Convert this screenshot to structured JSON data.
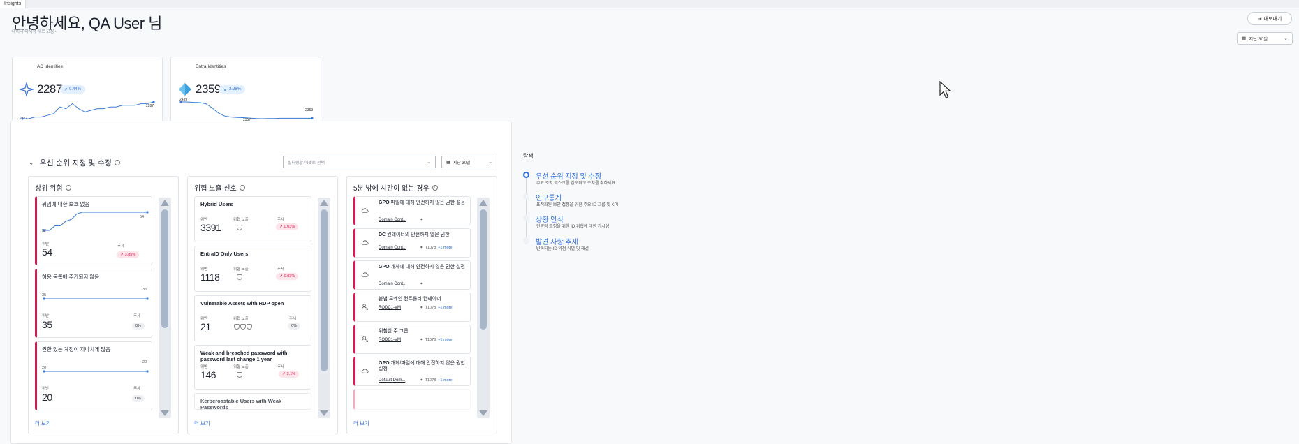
{
  "window": {
    "tab_title": "Insights"
  },
  "header": {
    "greeting": "안녕하세요, QA User 님",
    "subtitle": "데이터 마지막 새로 고침 -",
    "export_label": "내보내기",
    "range_label": "지난 30일"
  },
  "identities": [
    {
      "label": "AD Identities",
      "value": "2287",
      "trend": "0.44%",
      "icon": "ad-star-icon",
      "min": "2277",
      "max": "2287",
      "series": [
        2277,
        2277,
        2278,
        2278,
        2279,
        2280,
        2284,
        2283,
        2286,
        2283,
        2281,
        2282,
        2283,
        2283,
        2284,
        2284,
        2285,
        2285,
        2285,
        2286,
        2286,
        2287
      ]
    },
    {
      "label": "Entra Identities",
      "value": "2359",
      "trend": "-3.28%",
      "icon": "entra-diamond-icon",
      "start": "2439",
      "min": "2357",
      "end": "2359",
      "series": [
        2439,
        2439,
        2437,
        2436,
        2430,
        2410,
        2385,
        2370,
        2365,
        2363,
        2362,
        2360,
        2358,
        2357,
        2358,
        2358,
        2359,
        2359,
        2359,
        2359,
        2359,
        2359
      ]
    }
  ],
  "priority": {
    "title": "우선 순위 지정 및 수정",
    "asset_placeholder": "필터링할 애셋트 선택",
    "period": "지난 30일",
    "top_risks": {
      "title": "상위 위험",
      "more": "더 보기",
      "cards": [
        {
          "title": "위임에 대한 보호 없음",
          "value_label": "위반",
          "value": "54",
          "trend_label": "추세",
          "trend": "3.85%",
          "trend_dir": "up",
          "min": "52",
          "max": "54"
        },
        {
          "title": "허용 목록에 추가되지 않음",
          "value_label": "위반",
          "value": "35",
          "trend_label": "추세",
          "trend": "0%",
          "trend_dir": "flat",
          "min": "35",
          "max": "35"
        },
        {
          "title": "권한 있는 계정이 지나치게 많음",
          "value_label": "위반",
          "value": "20",
          "trend_label": "추세",
          "trend": "0%",
          "trend_dir": "flat",
          "min": "20",
          "max": "20"
        }
      ]
    },
    "exposure": {
      "title": "위협 노출 신호",
      "more": "더 보기",
      "cards": [
        {
          "title": "Hybrid Users",
          "violation_label": "위반",
          "value": "3391",
          "exposure_label": "위협 노출",
          "trend_label": "추세",
          "trend": "0.03%",
          "trend_dir": "up"
        },
        {
          "title": "EntraID Only Users",
          "violation_label": "위반",
          "value": "1118",
          "exposure_label": "위협 노출",
          "trend_label": "추세",
          "trend": "0.03%",
          "trend_dir": "up"
        },
        {
          "title": "Vulnerable Assets with RDP open",
          "violation_label": "위반",
          "value": "21",
          "exposure_label": "위협 노출",
          "trend_label": "추세",
          "trend": "0%",
          "trend_dir": "flat"
        },
        {
          "title": "Weak and breached password with password last change 1 year",
          "violation_label": "위반",
          "value": "146",
          "exposure_label": "위협 노출",
          "trend_label": "추세",
          "trend": "2.1%",
          "trend_dir": "up"
        },
        {
          "title": "Kerberoastable Users with Weak Passwords"
        }
      ]
    },
    "quick_wins": {
      "title": "5분 밖에 시간이 없는 경우",
      "more": "더 보기",
      "cards": [
        {
          "bold": "GPO",
          "text": " 파일에 대해 안전하지 않은 권한 설정",
          "sub": "Domain Cont...",
          "tag": "",
          "more": "",
          "icon": "cloud-icon"
        },
        {
          "bold": "DC",
          "text": " 컨테이너의 안전하지 않은 권한",
          "sub": "Domain Cont...",
          "tag": "T1078",
          "more": "+1 more",
          "icon": "cloud-icon"
        },
        {
          "bold": "GPO",
          "text": " 개체에 대해 안전하지 않은 권한 설정",
          "sub": "Domain Cont...",
          "tag": "",
          "more": "",
          "icon": "cloud-icon"
        },
        {
          "bold": "",
          "text": "불법 도메인 컨트롤러 컨테이너",
          "sub": "RODC1-VM",
          "tag": "T1078",
          "more": "+1 more",
          "icon": "user-key-icon"
        },
        {
          "bold": "",
          "text": "위험한 주 그룹",
          "sub": "RODC1-VM",
          "tag": "T1078",
          "more": "+1 more",
          "icon": "user-key-icon"
        },
        {
          "bold": "GPO",
          "text": " 개체/파일에 대해 안전하지 않은 권한 설정",
          "sub": "Default Dom...",
          "tag": "T1078",
          "more": "+1 more",
          "icon": "cloud-icon"
        }
      ]
    }
  },
  "toc": {
    "title": "탐색",
    "items": [
      {
        "label": "우선 순위 지정 및 수정",
        "desc": "주요 조치 리스크를 검토하고 조치를 취하세요"
      },
      {
        "label": "인구통계",
        "desc": "표적화된 보안 접점을 위한 주요 ID 그룹 및 KPI"
      },
      {
        "label": "상황 인식",
        "desc": "전략적 조정을 위한 ID 위협에 대한 가시성"
      },
      {
        "label": "발견 사항 추세",
        "desc": "반복되는 ID 약점 식별 및 해결"
      }
    ]
  },
  "colors": {
    "accent": "#2f6fdc",
    "danger": "#d81b4f",
    "line": "#3a7bd5"
  }
}
